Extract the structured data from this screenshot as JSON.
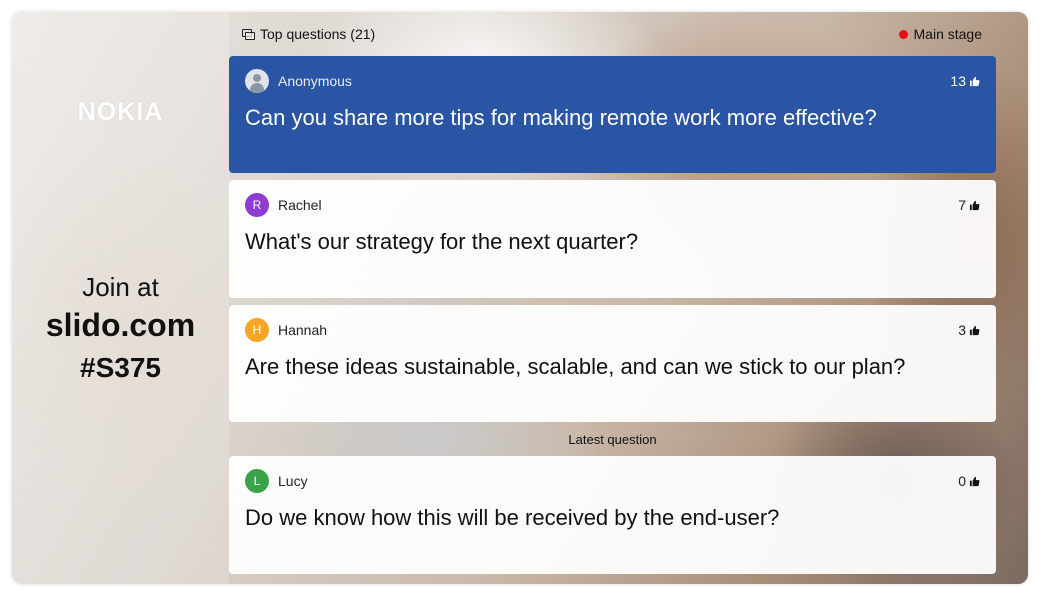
{
  "brand": {
    "logo_text": "NOKIA"
  },
  "join": {
    "line": "Join at",
    "site": "slido.com",
    "code": "#S375"
  },
  "header": {
    "title": "Top questions (21)",
    "stage": "Main stage",
    "stage_color": "#e3121a"
  },
  "questions": [
    {
      "author": "Anonymous",
      "initial": "",
      "avatar_color": "#dfe3ea",
      "votes": "13",
      "text": "Can you share more tips for making remote work more effective?",
      "highlighted": true
    },
    {
      "author": "Rachel",
      "initial": "R",
      "avatar_color": "#8e3ad6",
      "votes": "7",
      "text": "What's our strategy for the next quarter?",
      "highlighted": false
    },
    {
      "author": "Hannah",
      "initial": "H",
      "avatar_color": "#f5a623",
      "votes": "3",
      "text": "Are these ideas sustainable, scalable, and can we stick to our plan?",
      "highlighted": false
    }
  ],
  "latest": {
    "label": "Latest question",
    "author": "Lucy",
    "initial": "L",
    "avatar_color": "#3aa34a",
    "votes": "0",
    "text": "Do we know how this will be received by the end-user?"
  },
  "icons": {
    "comments": "comments-icon",
    "thumb": "thumbs-up-icon",
    "anonymous": "user-icon"
  },
  "accent_color": "#2a54a4"
}
